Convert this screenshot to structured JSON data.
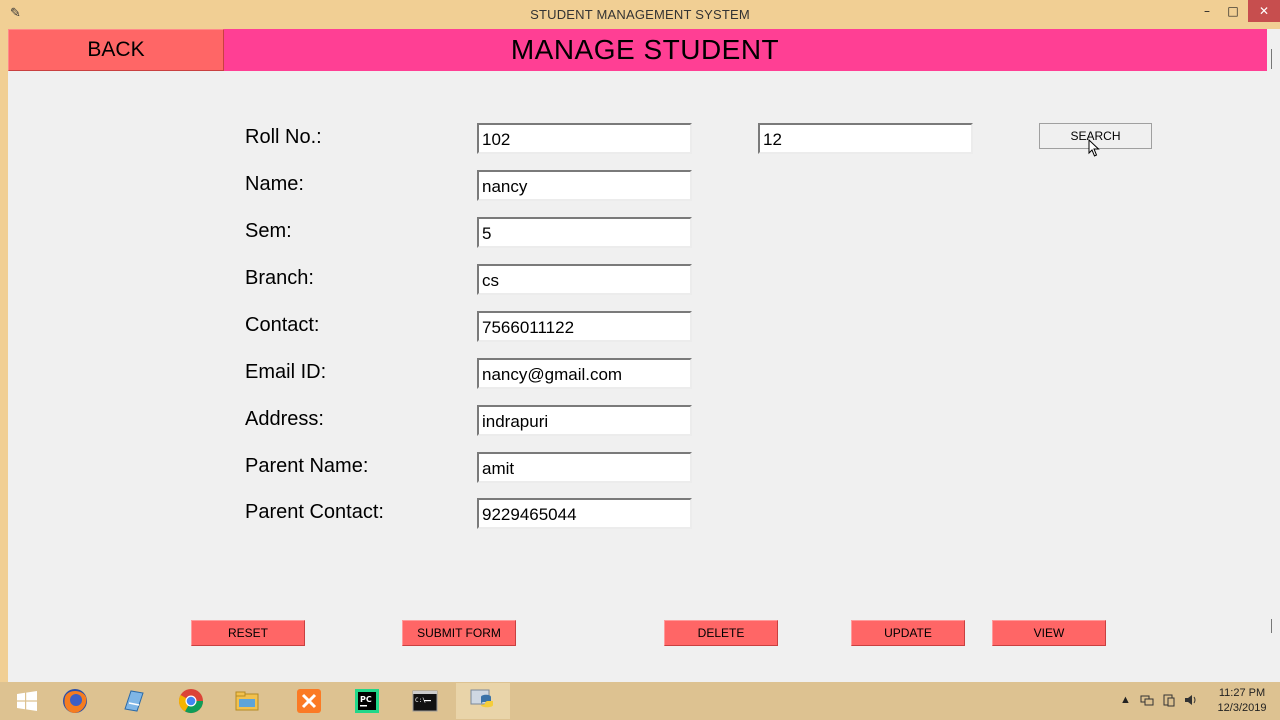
{
  "window": {
    "title": "STUDENT MANAGEMENT SYSTEM",
    "min_glyph": "–",
    "max_glyph": "□",
    "close_glyph": "✕"
  },
  "header": {
    "back_label": "BACK",
    "title": "MANAGE STUDENT"
  },
  "form": {
    "fields": [
      {
        "label": "Roll No.:",
        "value": "102"
      },
      {
        "label": "Name:",
        "value": "nancy"
      },
      {
        "label": "Sem:",
        "value": "5"
      },
      {
        "label": "Branch:",
        "value": "cs"
      },
      {
        "label": "Contact:",
        "value": "7566011122"
      },
      {
        "label": "Email ID:",
        "value": "nancy@gmail.com"
      },
      {
        "label": "Address:",
        "value": "indrapuri"
      },
      {
        "label": "Parent Name:",
        "value": "amit"
      },
      {
        "label": "Parent Contact:",
        "value": "9229465044"
      }
    ]
  },
  "search": {
    "value": "12",
    "button_label": "SEARCH"
  },
  "actions": {
    "reset": "RESET",
    "submit": "SUBMIT FORM",
    "delete": "DELETE",
    "update": "UPDATE",
    "view": "VIEW"
  },
  "taskbar": {
    "items": [
      "start-icon",
      "firefox-icon",
      "notepad-icon",
      "chrome-icon",
      "file-explorer-icon",
      "xampp-icon",
      "pycharm-icon",
      "cmd-icon",
      "python-icon"
    ],
    "time": "11:27 PM",
    "date": "12/3/2019"
  },
  "colors": {
    "header_pink": "#ff3f94",
    "button_red": "#ff6666",
    "title_bar": "#f1cf94"
  }
}
